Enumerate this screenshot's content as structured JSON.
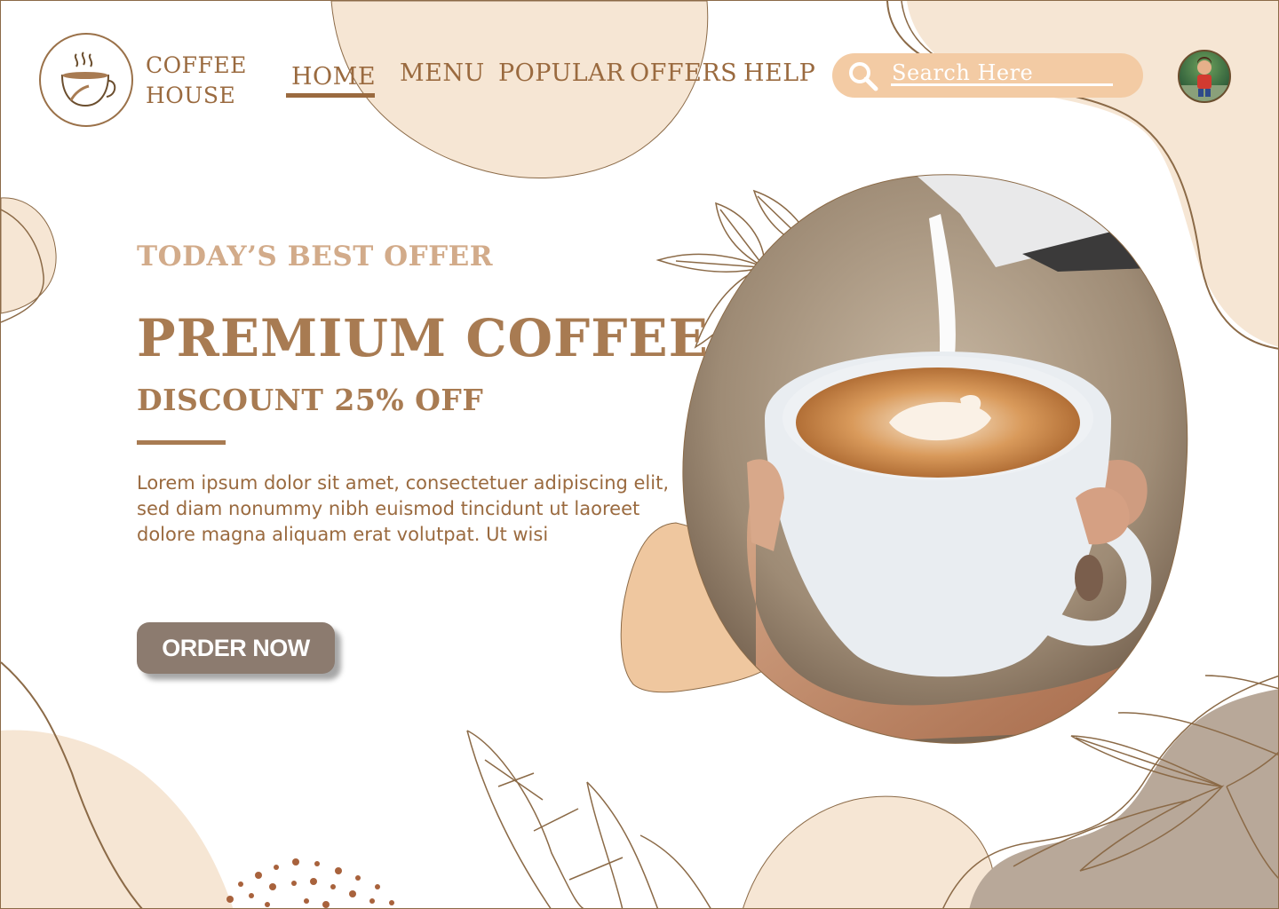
{
  "brand": {
    "line1": "COFFEE",
    "line2": "HOUSE"
  },
  "nav": {
    "items": [
      {
        "label": "HOME"
      },
      {
        "label": "MENU"
      },
      {
        "label": "POPULAR"
      },
      {
        "label": "OFFERS"
      },
      {
        "label": "HELP"
      }
    ],
    "active": "HOME"
  },
  "search": {
    "placeholder": "Search Here"
  },
  "hero": {
    "eyebrow": "TODAY’S BEST OFFER",
    "headline": "PREMIUM COFFEE",
    "discount": "DISCOUNT 25% OFF",
    "body": "Lorem ipsum dolor sit amet, consectetuer adipiscing elit, sed diam nonummy nibh euismod tincidunt ut laoreet dolore magna aliquam erat volutpat. Ut wisi",
    "cta": "ORDER NOW"
  },
  "colors": {
    "brand_brown": "#9a6a3f",
    "headline_brown": "#a87b52",
    "eyebrow_tan": "#d2ab8a",
    "blob_light": "#f6e6d4",
    "blob_peach": "#efc79f",
    "blob_taupe": "#b8a899",
    "search_fill": "#f3cba4",
    "button_fill": "#8c7b6f"
  },
  "icons": [
    "coffee-cup-icon",
    "search-icon",
    "leaf-icon"
  ]
}
